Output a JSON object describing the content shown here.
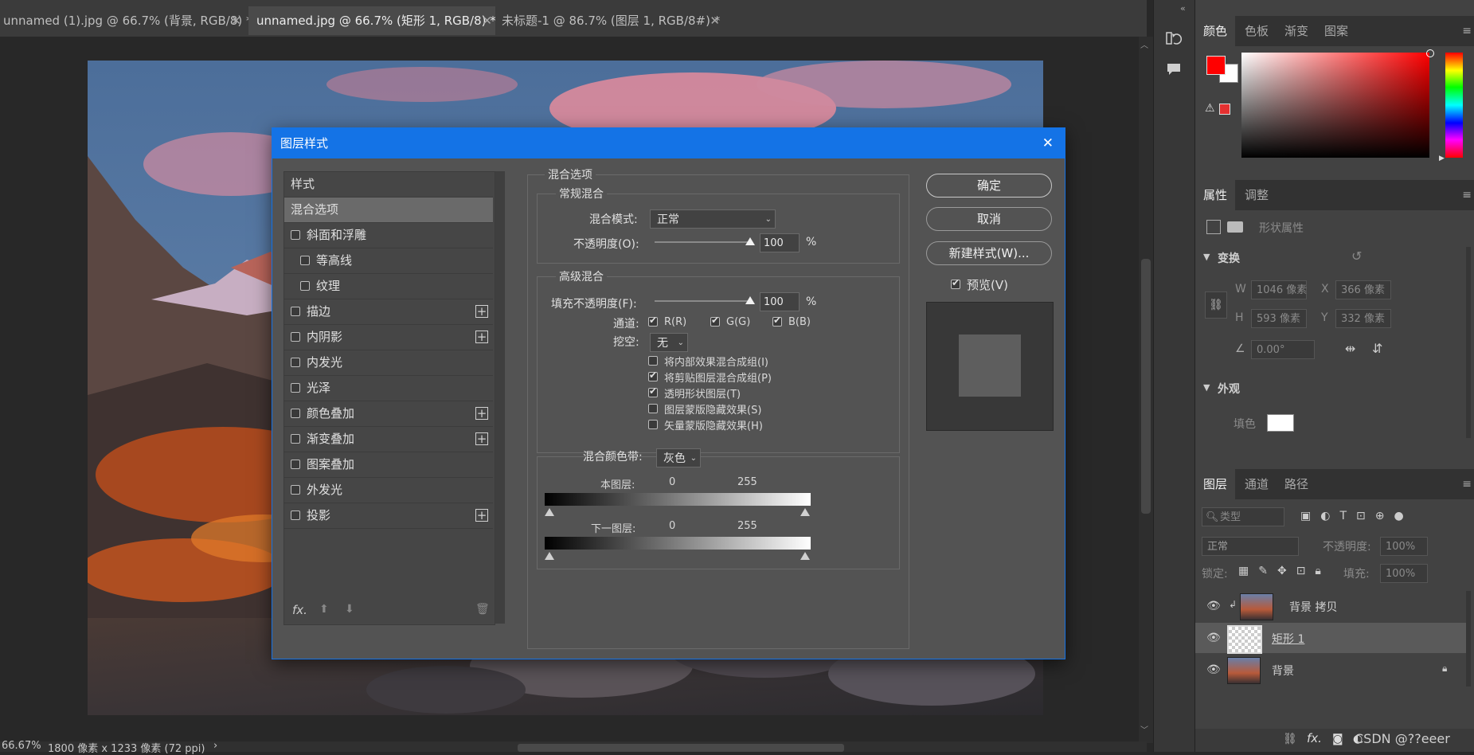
{
  "tabs": [
    {
      "label": "unnamed (1).jpg @ 66.7% (背景, RGB/8) *",
      "active": false
    },
    {
      "label": "unnamed.jpg @ 66.7% (矩形 1, RGB/8) *",
      "active": true
    },
    {
      "label": "未标题-1 @ 86.7% (图层 1, RGB/8#) *",
      "active": false
    }
  ],
  "status": {
    "zoom": "66.67%",
    "doc_info": "1800 像素 x 1233 像素 (72 ppi)",
    "arrow": "›"
  },
  "right_panel": {
    "color_tabs": [
      "颜色",
      "色板",
      "渐变",
      "图案"
    ],
    "colors": {
      "foreground": "#ff0000",
      "background": "#ffffff",
      "warning_swatch": "#e53030"
    },
    "props_tabs": [
      "属性",
      "调整"
    ],
    "props": {
      "kind": "形状属性",
      "transform_title": "变换",
      "w_label": "W",
      "w_value": "1046 像素",
      "x_label": "X",
      "x_value": "366 像素",
      "h_label": "H",
      "h_value": "593 像素",
      "y_label": "Y",
      "y_value": "332 像素",
      "angle_value": "0.00°",
      "appearance_title": "外观",
      "fill_label": "填色"
    },
    "layers_tabs": [
      "图层",
      "通道",
      "路径"
    ],
    "layers": {
      "filter_placeholder": "类型",
      "blend_mode": "正常",
      "opacity_label": "不透明度:",
      "opacity_value": "100%",
      "lock_label": "锁定:",
      "fill_label": "填充:",
      "fill_value": "100%",
      "items": [
        {
          "name": "背景 拷贝",
          "selected": false,
          "clipped": true
        },
        {
          "name": "矩形 1",
          "selected": true,
          "clipped": false
        },
        {
          "name": "背景",
          "selected": false,
          "locked": true
        }
      ]
    },
    "footer_fx": "fx.",
    "watermark": "CSDN @??eeer"
  },
  "dialog": {
    "title": "图层样式",
    "close": "✕",
    "style_header": "样式",
    "styles": [
      {
        "label": "混合选项",
        "selected": true,
        "checkbox": false,
        "plus": false
      },
      {
        "label": "斜面和浮雕",
        "checkbox": true,
        "checked": false,
        "plus": false
      },
      {
        "label": "等高线",
        "checkbox": true,
        "checked": false,
        "plus": false,
        "indent": true
      },
      {
        "label": "纹理",
        "checkbox": true,
        "checked": false,
        "plus": false,
        "indent": true
      },
      {
        "label": "描边",
        "checkbox": true,
        "checked": false,
        "plus": true
      },
      {
        "label": "内阴影",
        "checkbox": true,
        "checked": false,
        "plus": true
      },
      {
        "label": "内发光",
        "checkbox": true,
        "checked": false,
        "plus": false
      },
      {
        "label": "光泽",
        "checkbox": true,
        "checked": false,
        "plus": false
      },
      {
        "label": "颜色叠加",
        "checkbox": true,
        "checked": false,
        "plus": true
      },
      {
        "label": "渐变叠加",
        "checkbox": true,
        "checked": false,
        "plus": true
      },
      {
        "label": "图案叠加",
        "checkbox": true,
        "checked": false,
        "plus": false
      },
      {
        "label": "外发光",
        "checkbox": true,
        "checked": false,
        "plus": false
      },
      {
        "label": "投影",
        "checkbox": true,
        "checked": false,
        "plus": true
      }
    ],
    "footer_fx": "fx.",
    "section_title": "混合选项",
    "general": {
      "title": "常规混合",
      "mode_label": "混合模式:",
      "mode_value": "正常",
      "opacity_label": "不透明度(O):",
      "opacity_value": "100",
      "opacity_level": 1.0,
      "percent": "%"
    },
    "advanced": {
      "title": "高级混合",
      "fill_label": "填充不透明度(F):",
      "fill_value": "100",
      "fill_level": 1.0,
      "percent": "%",
      "channels_label": "通道:",
      "channels": [
        {
          "label": "R(R)",
          "checked": true
        },
        {
          "label": "G(G)",
          "checked": true
        },
        {
          "label": "B(B)",
          "checked": true
        }
      ],
      "knockout_label": "挖空:",
      "knockout_value": "无",
      "options": [
        {
          "label": "将内部效果混合成组(I)",
          "checked": false
        },
        {
          "label": "将剪贴图层混合成组(P)",
          "checked": true
        },
        {
          "label": "透明形状图层(T)",
          "checked": true
        },
        {
          "label": "图层蒙版隐藏效果(S)",
          "checked": false
        },
        {
          "label": "矢量蒙版隐藏效果(H)",
          "checked": false
        }
      ]
    },
    "blend_if": {
      "label": "混合颜色带:",
      "value": "灰色",
      "this_layer": "本图层:",
      "this_min": "0",
      "this_max": "255",
      "underlying": "下一图层:",
      "under_min": "0",
      "under_max": "255"
    },
    "buttons": {
      "ok": "确定",
      "cancel": "取消",
      "new_style": "新建样式(W)..."
    },
    "preview_label": "预览(V)",
    "preview_checked": true
  }
}
